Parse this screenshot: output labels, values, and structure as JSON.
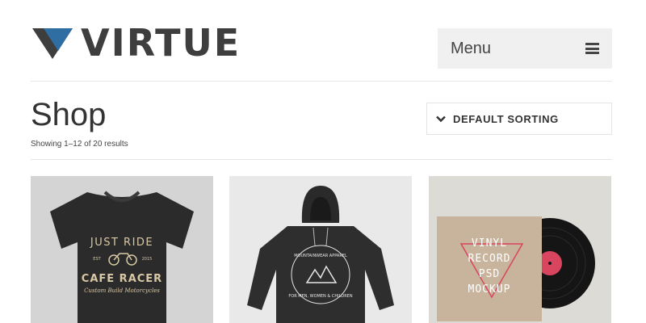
{
  "header": {
    "logo_text": "VIRTUE",
    "menu_label": "Menu"
  },
  "page": {
    "title": "Shop",
    "result_count": "Showing 1–12 of 20 results",
    "sorting_label": "DEFAULT SORTING"
  },
  "products": [
    {
      "image": "cafe-racer-tshirt-image",
      "image_text": [
        "JUST RIDE",
        "CAFE RACER",
        "Custom Build Motorcycles",
        "EST",
        "2015"
      ]
    },
    {
      "image": "mountain-hoodie-image",
      "image_text": [
        "MOUNTAINWEAR APPAREL",
        "FOR MEN, WOMEN & CHILDREN"
      ]
    },
    {
      "image": "vinyl-record-image",
      "image_text": [
        "VINYL",
        "RECORD",
        "PSD",
        "MOCKUP"
      ]
    }
  ],
  "colors": {
    "brand_blue": "#2f6ea3",
    "logo_dark": "#3e3e3e",
    "menu_bg": "#f0f0f0",
    "accent_pink": "#d9445f"
  }
}
